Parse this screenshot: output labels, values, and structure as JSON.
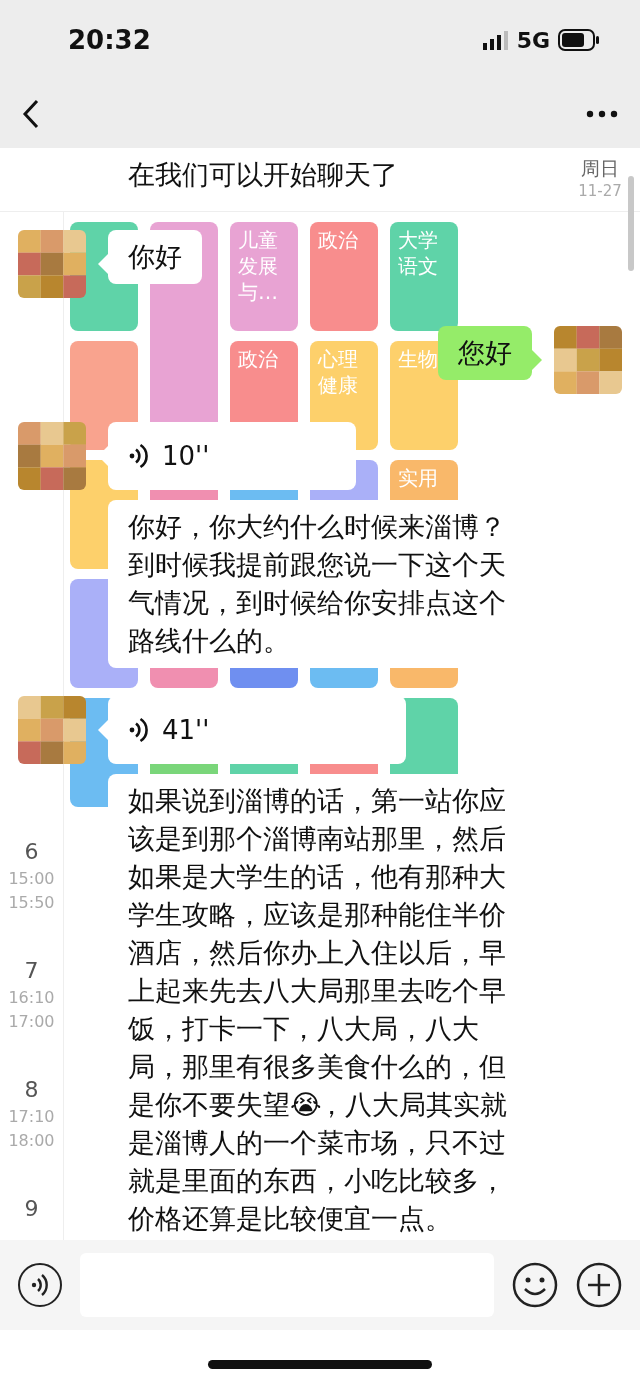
{
  "status_bar": {
    "time": "20:32",
    "network": "5G"
  },
  "timetable": {
    "header": {
      "day": "周日",
      "date": "11-27"
    },
    "rows": [
      [
        {
          "color": "#5fd3a8"
        },
        {
          "color": "#e8a3d3"
        },
        {
          "text": "儿童发展与…",
          "color": "#e8a3d3"
        },
        {
          "text": "政治",
          "color": "#f88d8d"
        },
        {
          "text": "大学语文",
          "color": "#5fd3a8"
        }
      ],
      [
        {
          "color": "#f9a38e"
        },
        {
          "color": "#e8a3d3"
        },
        {
          "text": "政治",
          "color": "#f88d8d"
        },
        {
          "text": "心理健康",
          "color": "#fdd06b"
        },
        {
          "text": "生物",
          "color": "#fdd06b"
        }
      ],
      [
        {
          "color": "#fdd06b"
        },
        {
          "color": "#f08fb0"
        },
        {
          "color": "#6cbcf2"
        },
        {
          "color": "#aab0f8"
        },
        {
          "text": "实用",
          "color": "#f9b86a"
        }
      ],
      [
        {
          "color": "#aab0f8"
        },
        {
          "color": "#f08fb0"
        },
        {
          "color": "#6f8ff0"
        },
        {
          "color": "#6cbcf2"
        },
        {
          "color": "#f9b86a"
        }
      ],
      [
        {
          "color": "#6cbcf2"
        },
        {
          "color": "#7ad67a"
        },
        {
          "color": "#5fd3a8"
        },
        {
          "color": "#f88d8d"
        },
        {
          "color": "#5fd3a8"
        }
      ]
    ],
    "periods": [
      {
        "number": "6",
        "start": "15:00",
        "end": "15:50"
      },
      {
        "number": "7",
        "start": "16:10",
        "end": "17:00"
      },
      {
        "number": "8",
        "start": "17:10",
        "end": "18:00"
      },
      {
        "number": "9"
      }
    ]
  },
  "messages": [
    {
      "outgoing": false,
      "kind": "text",
      "avatar": false,
      "text": "在我们可以开始聊天了"
    },
    {
      "outgoing": false,
      "kind": "text",
      "avatar": true,
      "text": "你好"
    },
    {
      "outgoing": true,
      "kind": "text",
      "avatar": true,
      "text": "您好"
    },
    {
      "outgoing": false,
      "kind": "voice",
      "avatar": true,
      "duration": "10''"
    },
    {
      "outgoing": false,
      "kind": "text",
      "avatar": false,
      "text": "你好，你大约什么时候来淄博？到时候我提前跟您说一下这个天气情况，到时候给你安排点这个路线什么的。"
    },
    {
      "outgoing": false,
      "kind": "voice",
      "avatar": true,
      "duration": "41''"
    },
    {
      "outgoing": false,
      "kind": "text",
      "avatar": false,
      "text": "如果说到淄博的话，第一站你应该是到那个淄博南站那里，然后如果是大学生的话，他有那种大学生攻略，应该是那种能住半价酒店，然后你办上入住以后，早上起来先去八大局那里去吃个早饭，打卡一下，八大局，八大局，那里有很多美食什么的，但是你不要失望😭，八大局其实就是淄博人的一个菜市场，只不过就是里面的东西，小吃比较多，价格还算是比较便宜一点。"
    }
  ]
}
